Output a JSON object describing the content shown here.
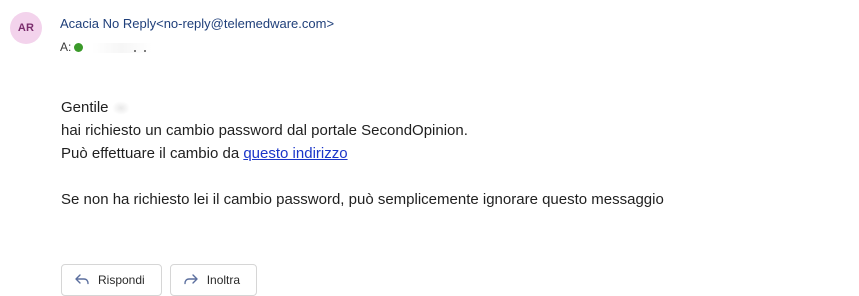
{
  "sender": {
    "initials": "AR",
    "name": "Acacia No Reply",
    "address": "<no-reply@telemedware.com>"
  },
  "recipient": {
    "label": "A:"
  },
  "message": {
    "greeting": "Gentile",
    "line1": "hai richiesto un cambio password dal portale SecondOpinion.",
    "line2_prefix": "Può effettuare il cambio da ",
    "line2_link": "questo indirizzo",
    "line3": "Se non ha richiesto lei il cambio password, può semplicemente ignorare questo messaggio"
  },
  "actions": {
    "reply_label": "Rispondi",
    "forward_label": "Inoltra"
  },
  "icons": {
    "reply": "reply-arrow-icon",
    "forward": "forward-arrow-icon",
    "presence": "presence-available-icon"
  },
  "colors": {
    "avatar_bg": "#f3d3ec",
    "avatar_text": "#7b2d6d",
    "sender_text": "#1f3f7a",
    "link": "#1a35c9",
    "presence": "#3b9a2a"
  }
}
